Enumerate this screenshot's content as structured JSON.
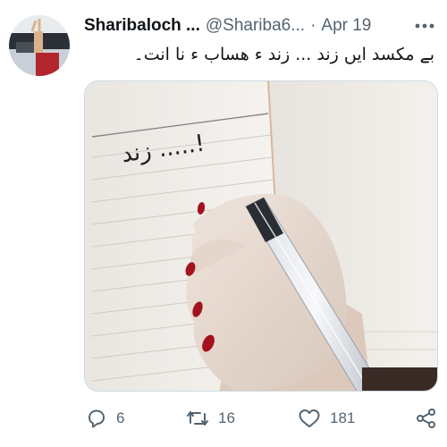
{
  "tweet": {
    "author_name": "Sharibaloch ...",
    "handle": "@Shariba6...",
    "separator": "·",
    "date": "Apr 19",
    "text": "بے مکسد ایں زند ... زند ء هساب ء نا انت۔",
    "image": {
      "handwriting": "زند .....!"
    }
  },
  "actions": {
    "replies": "6",
    "retweets": "16",
    "likes": "181"
  },
  "icons": {
    "reply": "reply-icon",
    "retweet": "retweet-icon",
    "like": "heart-icon",
    "share": "share-icon",
    "more": "more-icon"
  },
  "colors": {
    "name": "#0f1419",
    "secondary": "#536471",
    "border": "#cfd9de"
  }
}
